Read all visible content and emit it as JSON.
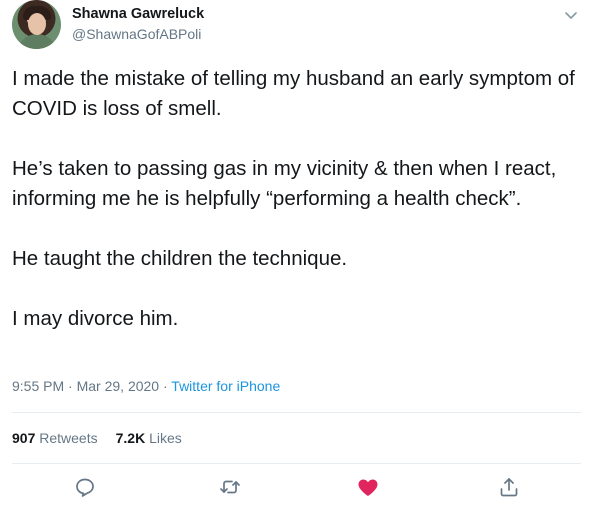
{
  "user": {
    "name": "Shawna Gawreluck",
    "handle": "@ShawnaGofABPoli"
  },
  "tweet": {
    "paragraphs": [
      "I made the mistake of telling my husband an early symptom of COVID is loss of smell.",
      "He’s taken to passing gas in my vicinity & then when I react, informing me he is helpfully “performing a health check”.",
      "He taught the children the technique.",
      "I may divorce him."
    ],
    "time": "9:55 PM",
    "separator1": " · ",
    "date": "Mar 29, 2020",
    "separator2": " · ",
    "source": "Twitter for iPhone"
  },
  "stats": {
    "retweets_count": "907",
    "retweets_label": "Retweets",
    "likes_count": "7.2K",
    "likes_label": "Likes"
  },
  "icons": {
    "reply": "reply-icon",
    "retweet": "retweet-icon",
    "like": "heart-icon",
    "share": "share-icon",
    "menu": "chevron-down-icon"
  },
  "colors": {
    "like_active": "#e0245e",
    "link": "#1b95e0",
    "secondary_text": "#657786"
  }
}
